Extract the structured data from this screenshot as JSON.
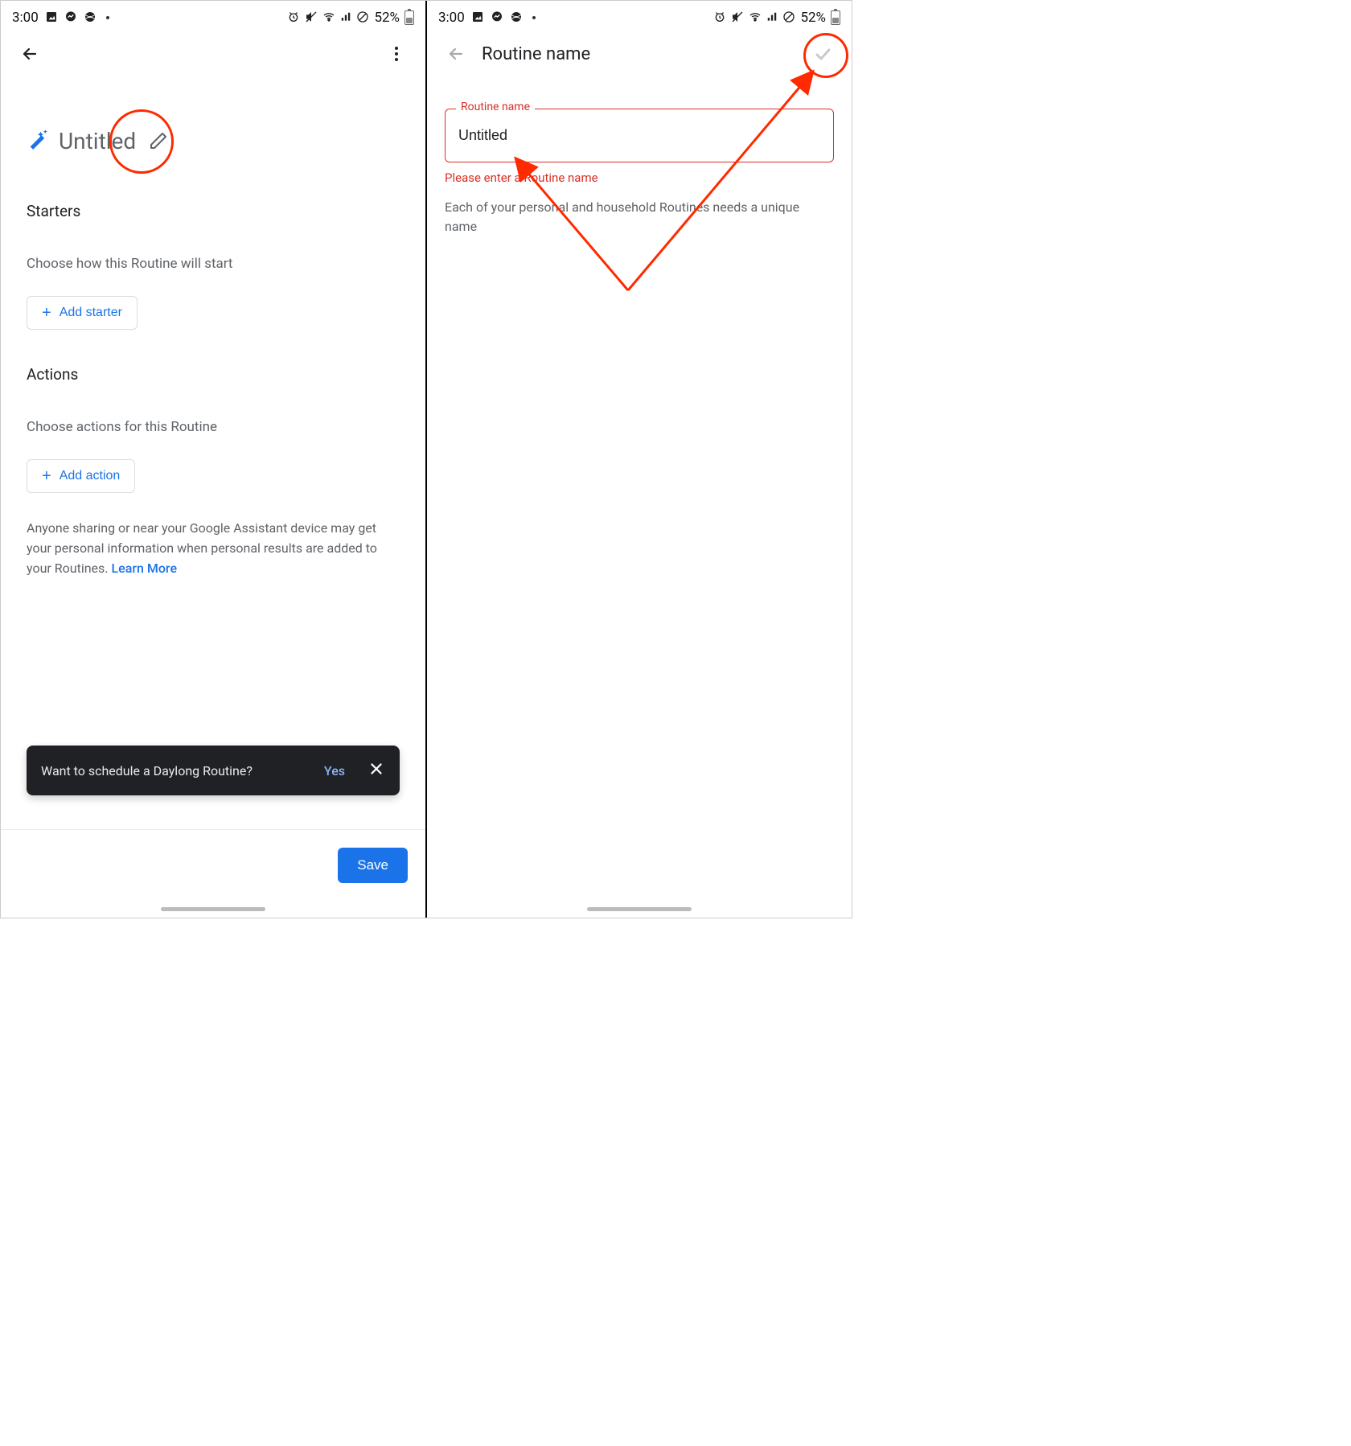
{
  "statusbar": {
    "time": "3:00",
    "battery": "52%"
  },
  "left": {
    "title": "Untitled",
    "starters_heading": "Starters",
    "starters_sub": "Choose how this Routine will start",
    "add_starter": "Add starter",
    "actions_heading": "Actions",
    "actions_sub": "Choose actions for this Routine",
    "add_action": "Add action",
    "disclaimer": "Anyone sharing or near your Google Assistant device may get your personal information when personal results are added to your Routines. ",
    "learn_more": "Learn More",
    "toast_text": "Want to schedule a Daylong Routine?",
    "toast_yes": "Yes",
    "save": "Save"
  },
  "right": {
    "title": "Routine name",
    "field_label": "Routine name",
    "field_value": "Untitled",
    "field_error": "Please enter a Routine name",
    "help": "Each of your personal and household Routines needs a unique name"
  }
}
